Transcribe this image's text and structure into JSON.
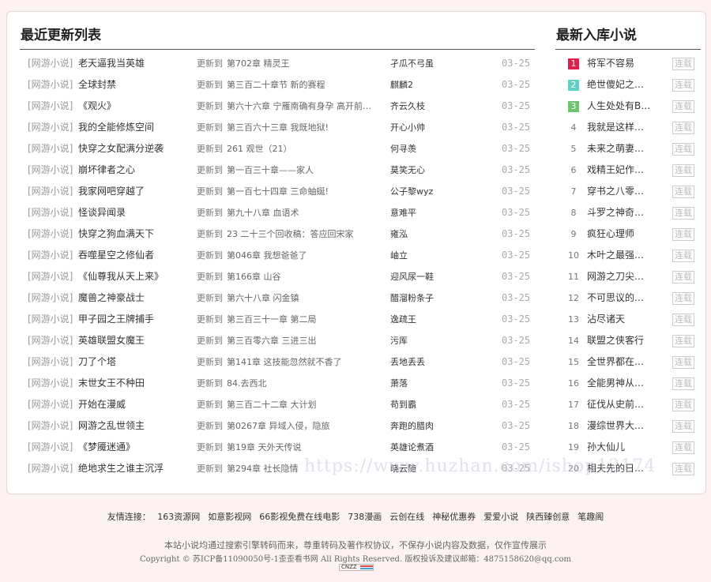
{
  "left": {
    "title": "最近更新列表",
    "update_prefix": "更新到",
    "rows": [
      {
        "cat": "[网游小说]",
        "title": "老天逼我当英雄",
        "chapter": "第702章 精灵王",
        "author": "孑瓜不弓虽",
        "date": "03-25"
      },
      {
        "cat": "[网游小说]",
        "title": "全球封禁",
        "chapter": "第三百二十章节 新的赛程",
        "author": "麒麟2",
        "date": "03-25"
      },
      {
        "cat": "[网游小说]",
        "title": "《观火》",
        "chapter": "第六十六章 宁雁南确有身孕 高开前…",
        "author": "齐云久枝",
        "date": "03-25"
      },
      {
        "cat": "[网游小说]",
        "title": "我的全能修炼空间",
        "chapter": "第三百六十三章 我既地狱!",
        "author": "开心小帅",
        "date": "03-25"
      },
      {
        "cat": "[网游小说]",
        "title": "快穿之女配满分逆袭",
        "chapter": "261 观世（21）",
        "author": "何寻羡",
        "date": "03-25"
      },
      {
        "cat": "[网游小说]",
        "title": "崩坏律者之心",
        "chapter": "第一百三十章——家人",
        "author": "莫笑无心",
        "date": "03-25"
      },
      {
        "cat": "[网游小说]",
        "title": "我家网吧穿越了",
        "chapter": "第一百七十四章 三命蚰蜒!",
        "author": "公子黎wyz",
        "date": "03-25"
      },
      {
        "cat": "[网游小说]",
        "title": "怪谈异闻录",
        "chapter": "第九十八章 血语术",
        "author": "意难平",
        "date": "03-25"
      },
      {
        "cat": "[网游小说]",
        "title": "快穿之狗血满天下",
        "chapter": "23 二十三个回收稿：答应回宋家",
        "author": "雍泓",
        "date": "03-25"
      },
      {
        "cat": "[网游小说]",
        "title": "吞噬星空之修仙者",
        "chapter": "第046章 我想爸爸了",
        "author": "岫立",
        "date": "03-25"
      },
      {
        "cat": "[网游小说]",
        "title": "《仙尊我从天上来》",
        "chapter": "第166章 山谷",
        "author": "迎风尿一鞋",
        "date": "03-25"
      },
      {
        "cat": "[网游小说]",
        "title": "魔兽之神豪战士",
        "chapter": "第六十八章 闪金镇",
        "author": "醋溜粉条子",
        "date": "03-25"
      },
      {
        "cat": "[网游小说]",
        "title": "甲子园之王牌捕手",
        "chapter": "第三百三十一章 第二局",
        "author": "逸疏王",
        "date": "03-25"
      },
      {
        "cat": "[网游小说]",
        "title": "英雄联盟女魔王",
        "chapter": "第三百零六章 三进三出",
        "author": "污厍",
        "date": "03-25"
      },
      {
        "cat": "[网游小说]",
        "title": "刀了个塔",
        "chapter": "第141章 这技能忽然就不香了",
        "author": "丢地丢丢",
        "date": "03-25"
      },
      {
        "cat": "[网游小说]",
        "title": "末世女王不种田",
        "chapter": "84.去西北",
        "author": "萧落",
        "date": "03-25"
      },
      {
        "cat": "[网游小说]",
        "title": "开始在漫威",
        "chapter": "第三百二十二章 大计划",
        "author": "苟到霸",
        "date": "03-25"
      },
      {
        "cat": "[网游小说]",
        "title": "网游之乱世领主",
        "chapter": "第0267章 异域入侵，隐旅",
        "author": "奔跑的腊肉",
        "date": "03-25"
      },
      {
        "cat": "[网游小说]",
        "title": "《梦魇迷通》",
        "chapter": "第19章 天外天传说",
        "author": "英雄论煮酒",
        "date": "03-25"
      },
      {
        "cat": "[网游小说]",
        "title": "绝地求生之谁主沉浮",
        "chapter": "第294章 社长隐情",
        "author": "晓云随",
        "date": "03-25"
      }
    ]
  },
  "right": {
    "title": "最新入库小说",
    "status_label": "连载",
    "items": [
      {
        "rank": "1",
        "name": "将军不容易"
      },
      {
        "rank": "2",
        "name": "绝世傻妃之卿…"
      },
      {
        "rank": "3",
        "name": "人生处处有BUG"
      },
      {
        "rank": "4",
        "name": "我就是这样汉子"
      },
      {
        "rank": "5",
        "name": "未来之萌妻等…"
      },
      {
        "rank": "6",
        "name": "戏精王妃作妖…"
      },
      {
        "rank": "7",
        "name": "穿书之八零女…"
      },
      {
        "rank": "8",
        "name": "斗罗之神奇的…"
      },
      {
        "rank": "9",
        "name": "疯狂心理师"
      },
      {
        "rank": "10",
        "name": "木叶之最强装逼"
      },
      {
        "rank": "11",
        "name": "网游之刀尖起舞"
      },
      {
        "rank": "12",
        "name": "不可思议的山海"
      },
      {
        "rank": "13",
        "name": "沾尽诸天"
      },
      {
        "rank": "14",
        "name": "联盟之侠客行"
      },
      {
        "rank": "15",
        "name": "全世界都在演…"
      },
      {
        "rank": "16",
        "name": "全能男神从绝…"
      },
      {
        "rank": "17",
        "name": "征伐从史前人…"
      },
      {
        "rank": "18",
        "name": "漫综世界大枭雄"
      },
      {
        "rank": "19",
        "name": "孙大仙儿"
      },
      {
        "rank": "20",
        "name": "相夫先的日利…"
      }
    ]
  },
  "friend_links": {
    "label": "友情连接：",
    "items": [
      "163资源网",
      "如意影视网",
      "66影视免费在线电影",
      "738漫画",
      "云创在线",
      "神秘优惠券",
      "爱爱小说",
      "陕西臻创意",
      "笔趣阁"
    ]
  },
  "footer": {
    "line1": "本站小说均通过搜索引擎转码而来，尊重转码及著作权协议，不保存小说内容及数据，仅作宣传展示",
    "line2": "Copyright © 苏ICP备11090050号-1歪歪看书网 All Rights Reserved. 版权投诉及建议邮箱：4875158620@qq.com",
    "cnzz": "CNZZ"
  },
  "watermark": "https://www.huzhan.com/ishop12174",
  "colors": {
    "rank1": "#e0204a",
    "rank2": "#5fd0c4",
    "rank3": "#6cc46c",
    "background": "#fdf2f2"
  }
}
